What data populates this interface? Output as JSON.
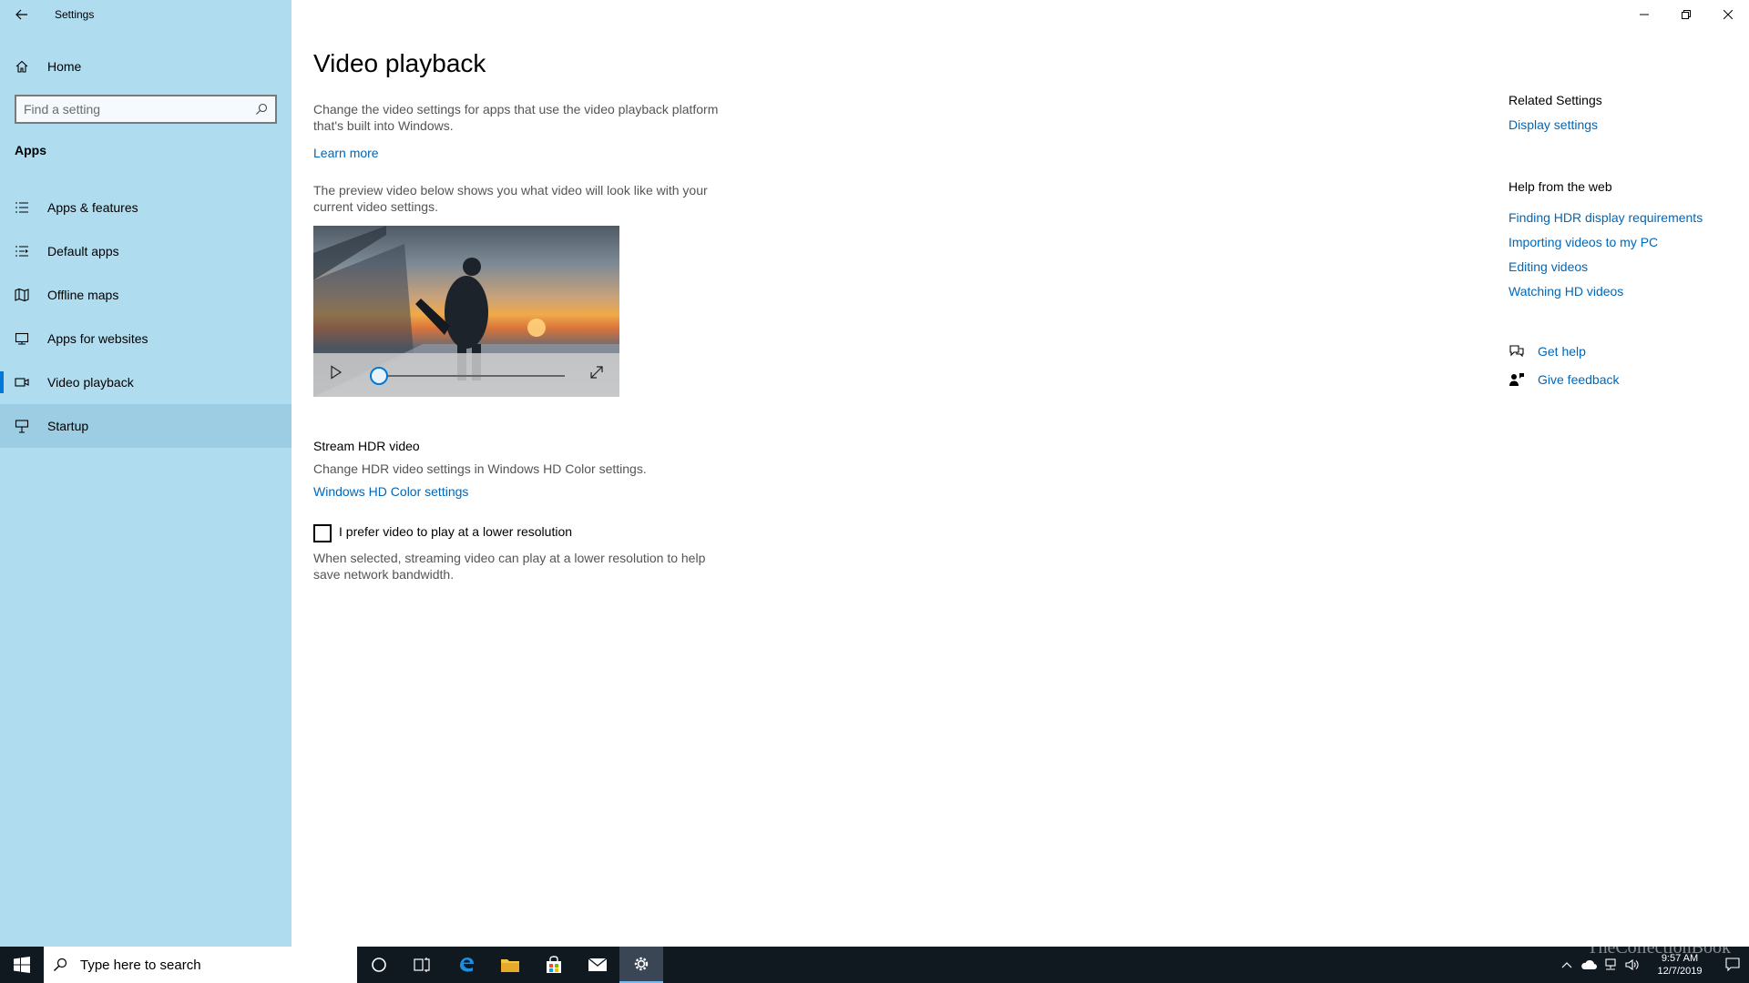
{
  "window": {
    "title": "Settings",
    "controls": [
      "minimize",
      "restore",
      "close"
    ]
  },
  "sidebar": {
    "home_label": "Home",
    "search_placeholder": "Find a setting",
    "section_title": "Apps",
    "items": [
      {
        "label": "Apps & features",
        "icon": "list-icon"
      },
      {
        "label": "Default apps",
        "icon": "default-apps-icon"
      },
      {
        "label": "Offline maps",
        "icon": "map-icon"
      },
      {
        "label": "Apps for websites",
        "icon": "web-apps-icon"
      },
      {
        "label": "Video playback",
        "icon": "video-icon",
        "selected": true
      },
      {
        "label": "Startup",
        "icon": "startup-icon",
        "hover": true
      }
    ]
  },
  "main": {
    "title": "Video playback",
    "intro": "Change the video settings for apps that use the video playback platform that's built into Windows.",
    "learn_more": "Learn more",
    "preview_desc": "The preview video below shows you what video will look like with your current video settings.",
    "hdr_heading": "Stream HDR video",
    "hdr_desc": "Change HDR video settings in Windows HD Color settings.",
    "hdr_link": "Windows HD Color settings",
    "lowres_checkbox_label": "I prefer video to play at a lower resolution",
    "lowres_checked": false,
    "lowres_desc": "When selected, streaming video can play at a lower resolution to help save network bandwidth.",
    "video_progress": 0
  },
  "related": {
    "title": "Related Settings",
    "links": [
      "Display settings"
    ]
  },
  "help_web": {
    "title": "Help from the web",
    "links": [
      "Finding HDR display requirements",
      "Importing videos to my PC",
      "Editing videos",
      "Watching HD videos"
    ]
  },
  "help_actions": {
    "get_help": "Get help",
    "give_feedback": "Give feedback"
  },
  "taskbar": {
    "search_placeholder": "Type here to search",
    "time": "9:57 AM",
    "date": "12/7/2019",
    "watermark": "TheCollectionBook"
  },
  "colors": {
    "sidebar_bg": "#b0dcef",
    "accent": "#0078d7",
    "link": "#0067b8",
    "taskbar_bg": "#101820"
  }
}
